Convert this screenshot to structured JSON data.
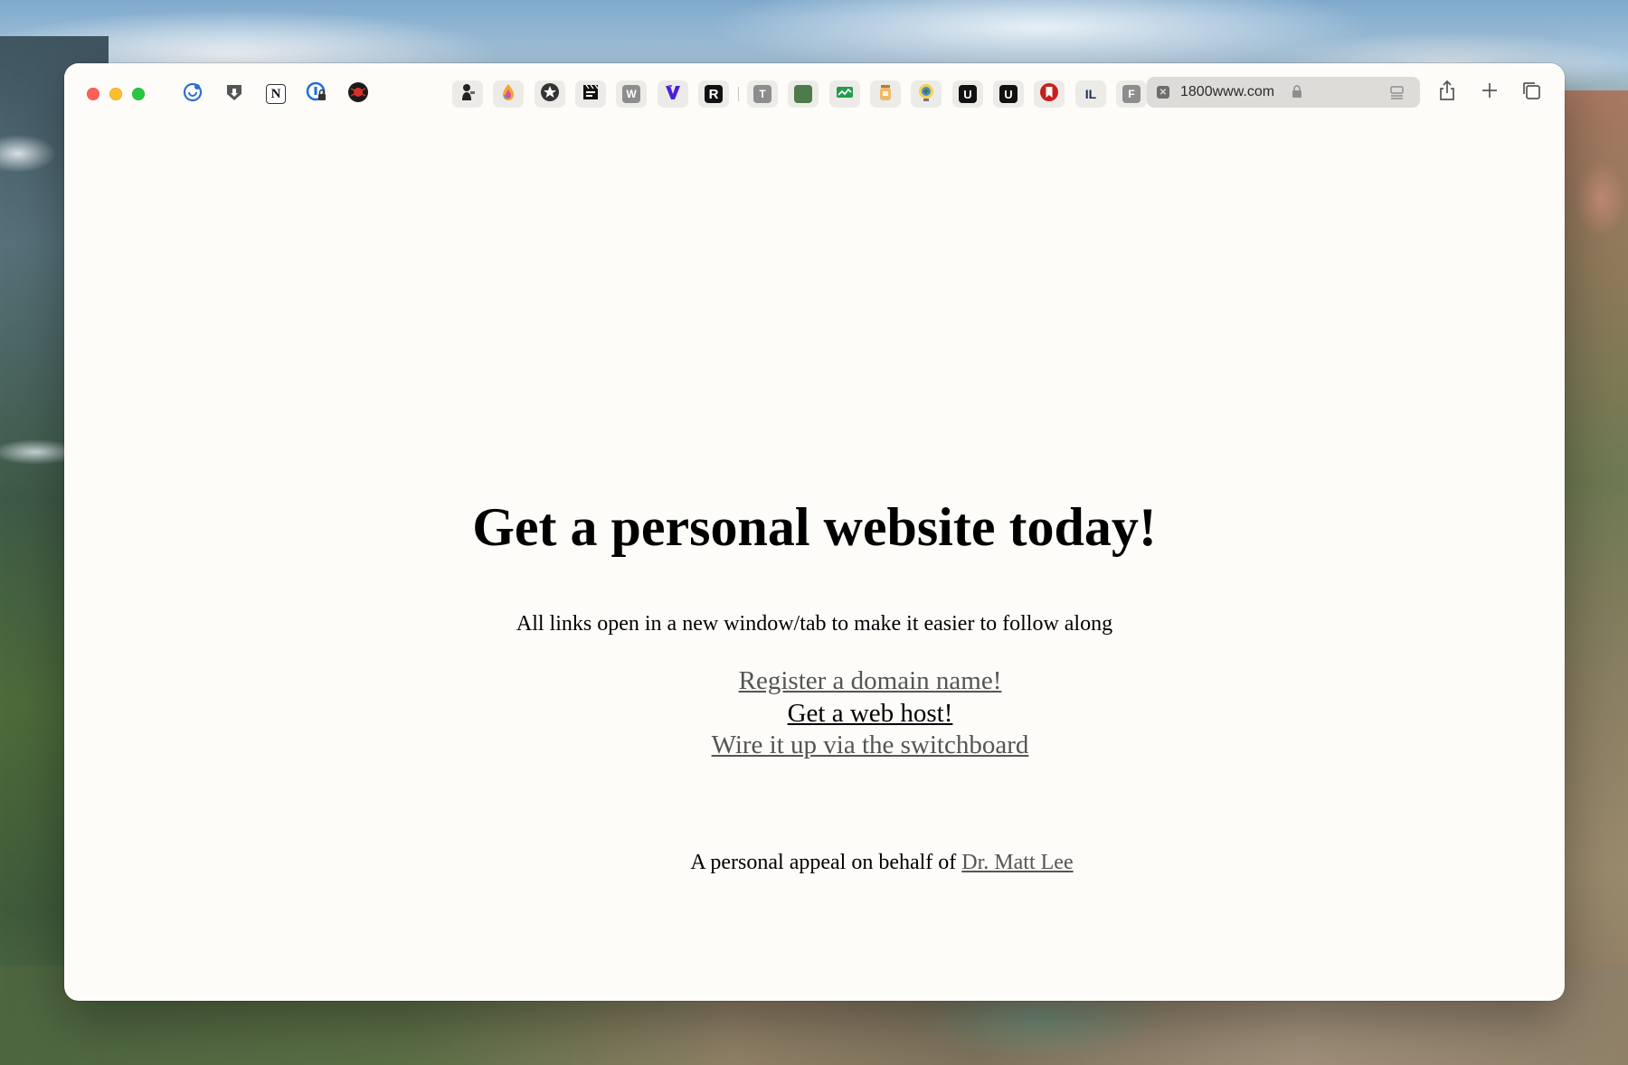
{
  "browser": {
    "url": "1800www.com",
    "bookmarks": [
      {
        "name": "circle-logo-icon"
      },
      {
        "name": "shield-bookmark-icon"
      },
      {
        "name": "notion-icon",
        "letter": "N"
      },
      {
        "name": "password-lock-icon"
      },
      {
        "name": "red-spider-icon"
      },
      {
        "name": "person-figure-icon"
      },
      {
        "name": "color-flame-icon"
      },
      {
        "name": "star-badge-icon"
      },
      {
        "name": "clapper-icon"
      },
      {
        "name": "w-letter-icon",
        "letter": "W"
      },
      {
        "name": "v-logo-icon",
        "letter": "V"
      },
      {
        "name": "r-logo-icon",
        "letter": "R"
      },
      {
        "name": "t-letter-icon",
        "letter": "T"
      },
      {
        "name": "green-square-icon"
      },
      {
        "name": "green-chart-icon"
      },
      {
        "name": "jar-icon"
      },
      {
        "name": "globe-bulb-icon"
      },
      {
        "name": "u-dark-icon",
        "letter": "U"
      },
      {
        "name": "u-dark-icon-2",
        "letter": "U"
      },
      {
        "name": "red-bookmark-icon"
      },
      {
        "name": "il-letters-icon",
        "letter": "IL"
      },
      {
        "name": "f-letter-icon",
        "letter": "F"
      },
      {
        "name": "book-icon"
      }
    ]
  },
  "page": {
    "headline": "Get a personal website today!",
    "subtext": "All links open in a new window/tab to make it easier to follow along",
    "links": [
      "Register a domain name!",
      "Get a web host!",
      "Wire it up via the switchboard"
    ],
    "appeal_prefix": "A personal appeal on behalf of",
    "appeal_link": "Dr. Matt Lee"
  },
  "colors": {
    "link": "#555555",
    "link_dark": "#000000",
    "page_background": "#fdfcf9"
  }
}
